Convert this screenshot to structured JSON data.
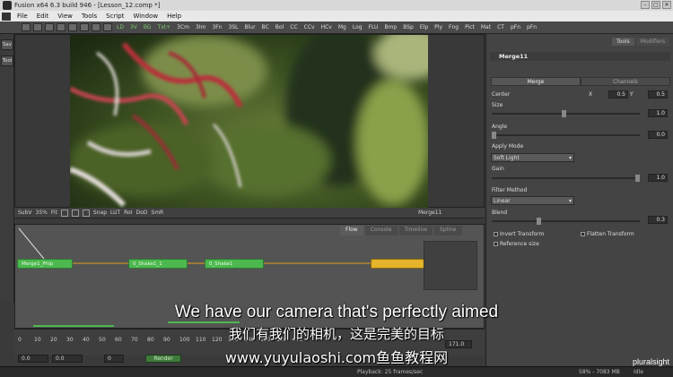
{
  "window": {
    "title": "Fusion x64 6.3 build 946 - [Lesson_12.comp *]"
  },
  "menu": [
    "File",
    "Edit",
    "View",
    "Tools",
    "Script",
    "Window",
    "Help"
  ],
  "toolbar_tools": [
    "LD",
    "3V",
    "BG",
    "Txt+",
    "3Cm",
    "3Im",
    "3Fn",
    "3SL",
    "Blur",
    "BC",
    "Bol",
    "CC",
    "CCv",
    "HCv",
    "Mg",
    "Log",
    "FLU",
    "Bmp",
    "BSp",
    "Elp",
    "Ply",
    "Fng",
    "Pict",
    "Mat",
    "CT",
    "pFn",
    "pFn"
  ],
  "leftbar": [
    "Sav",
    "Tool"
  ],
  "viewbar": {
    "left": [
      "SubV",
      "35%",
      "Fit",
      "Snap",
      "LUT",
      "RoI",
      "DoD",
      "SmR"
    ],
    "node_name": "Merge11"
  },
  "flow": {
    "tabs": [
      "Flow",
      "Console",
      "Timeline",
      "Spline"
    ],
    "nodes": [
      "Merge1_Phlp",
      "0_Shake1_1",
      "0_Shake1"
    ]
  },
  "timeline": {
    "ticks": [
      "0",
      "10",
      "20",
      "30",
      "40",
      "50",
      "60",
      "70",
      "80",
      "90",
      "100",
      "110",
      "120",
      "130",
      "140",
      "150",
      "160",
      "170"
    ],
    "start": "0.0",
    "end": "0.0",
    "current": "0",
    "right_value": "171.0",
    "render_label": "Render"
  },
  "right_panel": {
    "tabs": [
      "Tools",
      "Modifiers"
    ],
    "node_title": "Merge11",
    "subtabs": [
      "Merge",
      "Channels"
    ],
    "center_label": "Center",
    "center_x_label": "X",
    "center_x": "0.5",
    "center_y_label": "Y",
    "center_y": "0.5",
    "size_label": "Size",
    "size": "1.0",
    "angle_label": "Angle",
    "angle": "0.0",
    "apply_mode_label": "Apply Mode",
    "apply_mode": "Soft Light",
    "gain_label": "Gain",
    "gain": "1.0",
    "filter_method_label": "Filter Method",
    "filter_method": "Linear",
    "blend_label": "Blend",
    "blend": "0.3",
    "invert_transform": "Invert Transform",
    "flatten_transform": "Flatten Transform",
    "reference_size": "Reference size"
  },
  "status": {
    "playback": "Playback: 25 frames/sec",
    "memory": "58% - 7083 MB",
    "idle": "Idle"
  },
  "subtitles": {
    "en": "We have our camera that's perfectly aimed",
    "cn": "我们有我们的相机，这是完美的目标",
    "url": "www.yuyulaoshi.com鱼鱼教程网"
  },
  "watermark": "pluralsight",
  "colors": {
    "node_green": "#4cb84f",
    "node_yellow": "#e6b42a",
    "accent": "#c8c8c8"
  }
}
